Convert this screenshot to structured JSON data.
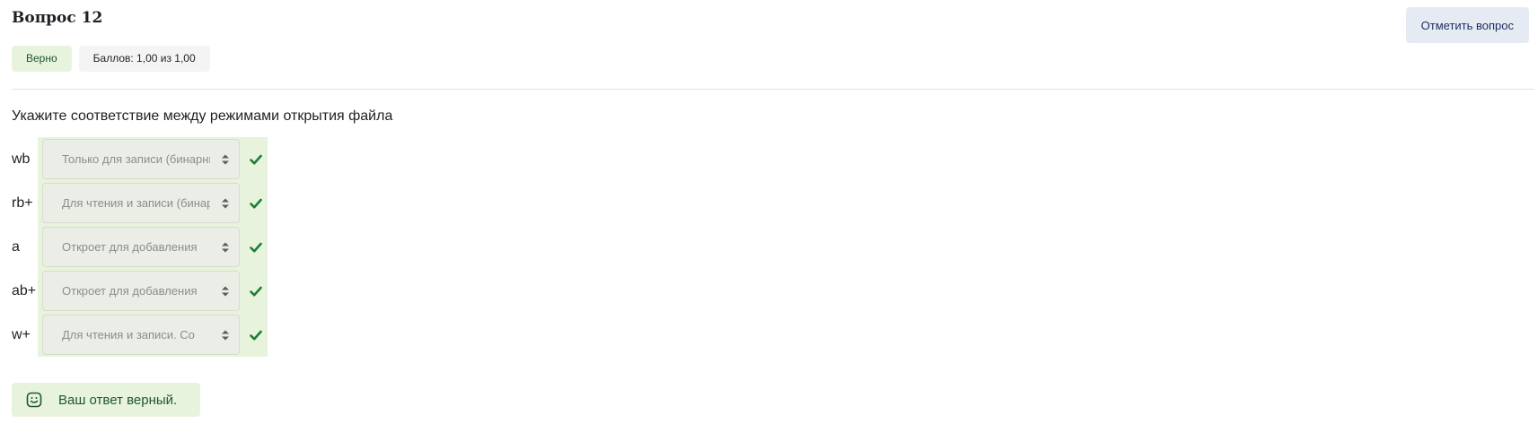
{
  "question": {
    "title": "Вопрос 12",
    "status_badge": "Верно",
    "score_badge": "Баллов: 1,00 из 1,00",
    "flag_button": "Отметить вопрос",
    "prompt": "Укажите соответствие между режимами открытия файла"
  },
  "rows": [
    {
      "term": "wb",
      "selected": "Только для записи (бинарный)",
      "status": "correct"
    },
    {
      "term": "rb+",
      "selected": "Для чтения и записи (бинарный)",
      "status": "correct"
    },
    {
      "term": "a",
      "selected": "Откроет для добавления",
      "status": "correct"
    },
    {
      "term": "ab+",
      "selected": "Откроет для добавления",
      "status": "correct"
    },
    {
      "term": "w+",
      "selected": "Для чтения и записи. Со",
      "status": "correct"
    }
  ],
  "feedback": {
    "icon": "smile-icon",
    "text": "Ваш ответ верный."
  },
  "colors": {
    "correct_bg": "#e7f3dc",
    "check": "#1a7f37",
    "flag_bg": "#e6eaf3"
  }
}
